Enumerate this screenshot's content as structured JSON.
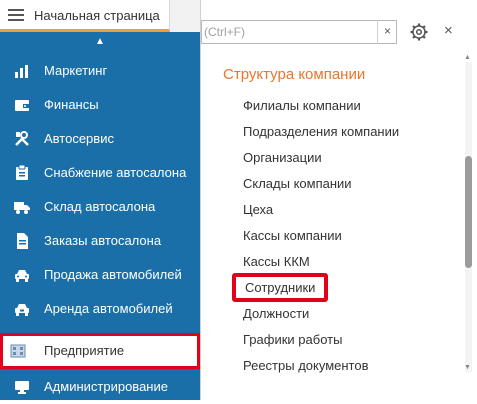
{
  "tabs": {
    "home_label": "Начальная страница"
  },
  "sidebar": {
    "items": [
      {
        "label": "Маркетинг",
        "icon": "bar-chart-icon"
      },
      {
        "label": "Финансы",
        "icon": "wallet-icon"
      },
      {
        "label": "Автосервис",
        "icon": "tools-icon"
      },
      {
        "label": "Снабжение автосалона",
        "icon": "clipboard-icon"
      },
      {
        "label": "Склад автосалона",
        "icon": "truck-icon"
      },
      {
        "label": "Заказы автосалона",
        "icon": "document-icon"
      },
      {
        "label": "Продажа автомобилей",
        "icon": "car-icon"
      },
      {
        "label": "Аренда автомобилей",
        "icon": "car-rental-icon"
      },
      {
        "label": "Предприятие",
        "icon": "building-icon",
        "selected": true
      },
      {
        "label": "Администрирование",
        "icon": "monitor-icon"
      }
    ]
  },
  "panel": {
    "search_placeholder": "(Ctrl+F)",
    "clear_symbol": "×",
    "close_symbol": "×",
    "section_title": "Структура компании",
    "items": [
      {
        "label": "Филиалы компании"
      },
      {
        "label": "Подразделения компании"
      },
      {
        "label": "Организации"
      },
      {
        "label": "Склады компании"
      },
      {
        "label": "Цеха"
      },
      {
        "label": "Кассы компании"
      },
      {
        "label": "Кассы ККМ"
      },
      {
        "label": "Сотрудники",
        "highlighted": true
      },
      {
        "label": "Должности"
      },
      {
        "label": "Графики работы"
      },
      {
        "label": "Реестры документов"
      }
    ]
  },
  "colors": {
    "sidebar_bg": "#1a6fa8",
    "highlight": "#e3001b",
    "section_title": "#e8762c",
    "tab_accent": "#f0a030"
  }
}
